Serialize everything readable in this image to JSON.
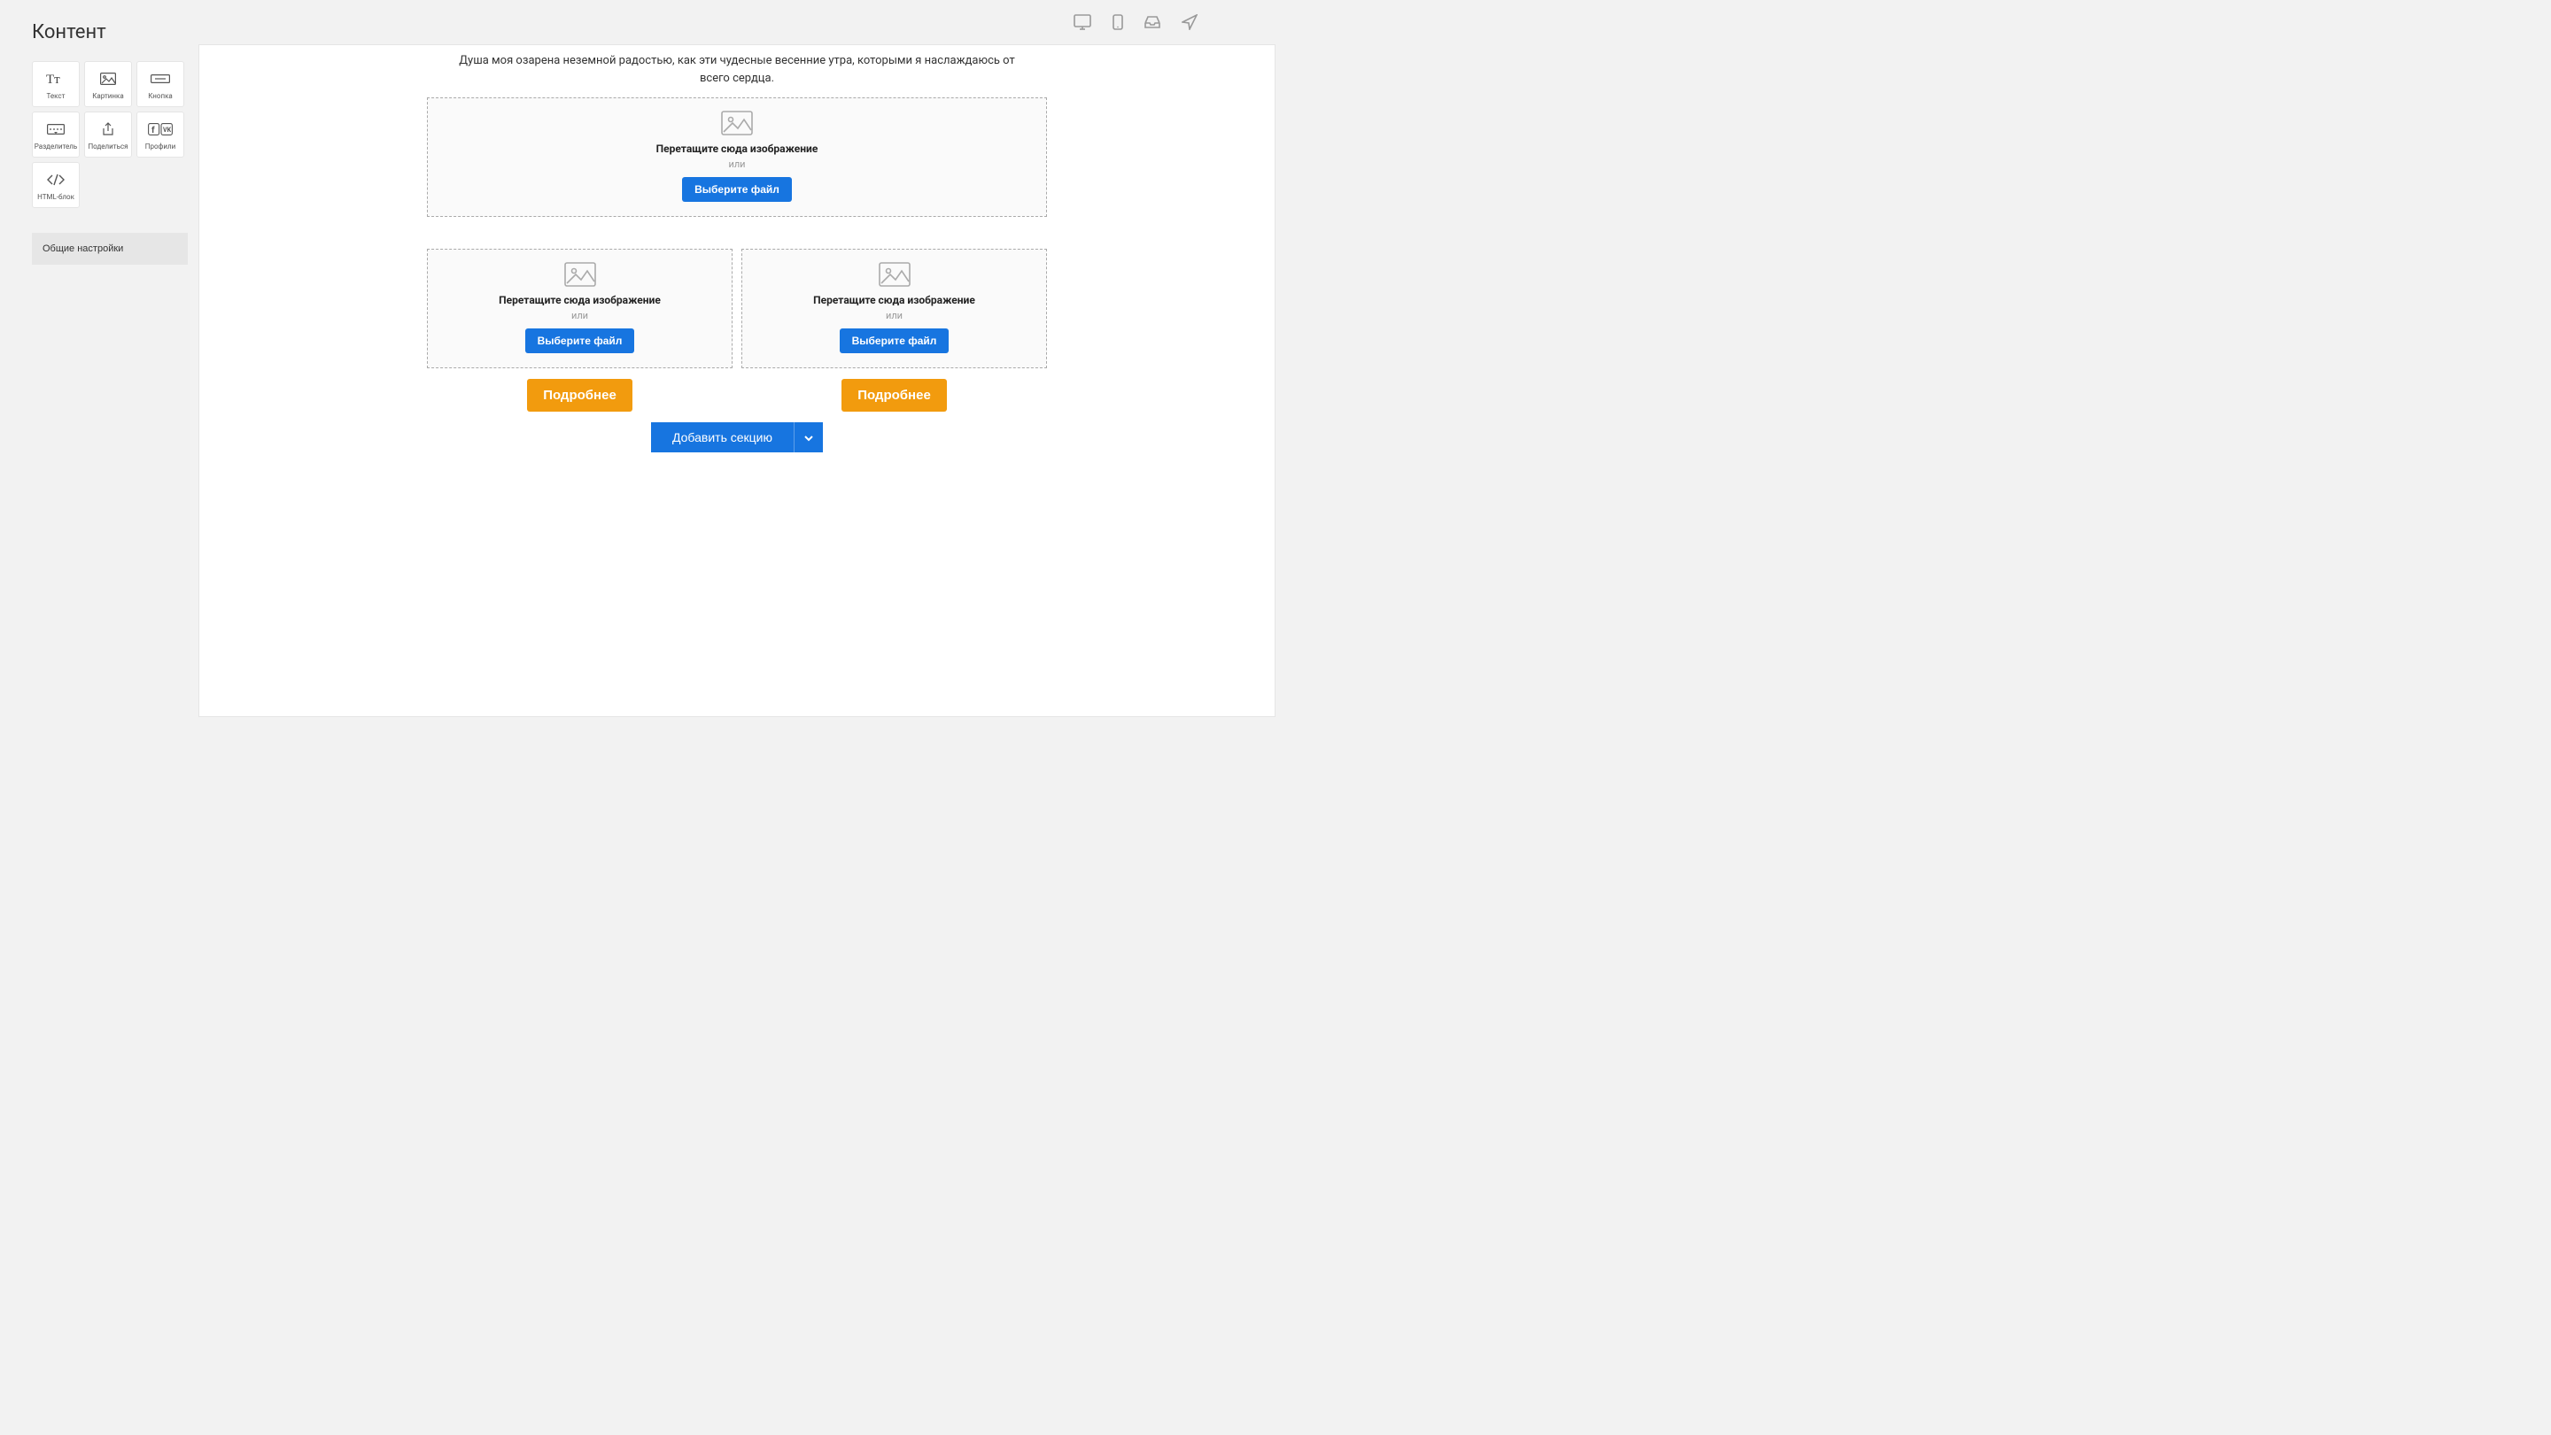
{
  "sidebar": {
    "title": "Контент",
    "blocks": [
      {
        "label": "Текст",
        "icon": "text"
      },
      {
        "label": "Картинка",
        "icon": "image"
      },
      {
        "label": "Кнопка",
        "icon": "button"
      },
      {
        "label": "Разделитель",
        "icon": "divider"
      },
      {
        "label": "Поделиться",
        "icon": "share"
      },
      {
        "label": "Профили",
        "icon": "profiles"
      },
      {
        "label": "HTML-блок",
        "icon": "html"
      }
    ],
    "settings_label": "Общие настройки"
  },
  "topbar": {
    "icons": [
      "desktop",
      "mobile",
      "inbox",
      "send"
    ]
  },
  "canvas": {
    "intro_text": "Душа моя озарена неземной радостью, как эти чудесные весенние утра, которыми я наслаждаюсь от всего сердца.",
    "dropzone": {
      "title": "Перетащите сюда изображение",
      "or": "или",
      "button": "Выберите файл"
    },
    "more_button": "Подробнее",
    "add_section": "Добавить секцию"
  }
}
